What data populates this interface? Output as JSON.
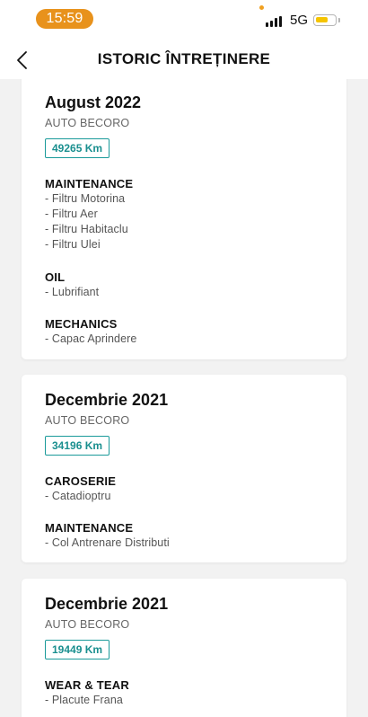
{
  "status_bar": {
    "time": "15:59",
    "network": "5G",
    "battery_level": 0.7,
    "accent_color": "#e8921c"
  },
  "header": {
    "title": "ISTORIC ÎNTREȚINERE",
    "back_icon": "chevron-left-icon"
  },
  "records": [
    {
      "date": "August 2022",
      "dealer": "AUTO BECORO",
      "km": "49265 Km",
      "sections": [
        {
          "title": "MAINTENANCE",
          "items": [
            "- Filtru Motorina",
            "- Filtru Aer",
            "- Filtru Habitaclu",
            "- Filtru Ulei"
          ]
        },
        {
          "title": "OIL",
          "items": [
            "- Lubrifiant"
          ]
        },
        {
          "title": "MECHANICS",
          "items": [
            "- Capac Aprindere"
          ]
        }
      ]
    },
    {
      "date": "Decembrie 2021",
      "dealer": "AUTO BECORO",
      "km": "34196 Km",
      "sections": [
        {
          "title": "CAROSERIE",
          "items": [
            "- Catadioptru"
          ]
        },
        {
          "title": "MAINTENANCE",
          "items": [
            "- Col Antrenare Distributi"
          ]
        }
      ]
    },
    {
      "date": "Decembrie 2021",
      "dealer": "AUTO BECORO",
      "km": "19449 Km",
      "sections": [
        {
          "title": "WEAR & TEAR",
          "items": [
            "- Placute Frana"
          ]
        }
      ]
    }
  ],
  "colors": {
    "badge": "#1a9a9a",
    "background": "#f2f2f2",
    "card": "#ffffff"
  }
}
